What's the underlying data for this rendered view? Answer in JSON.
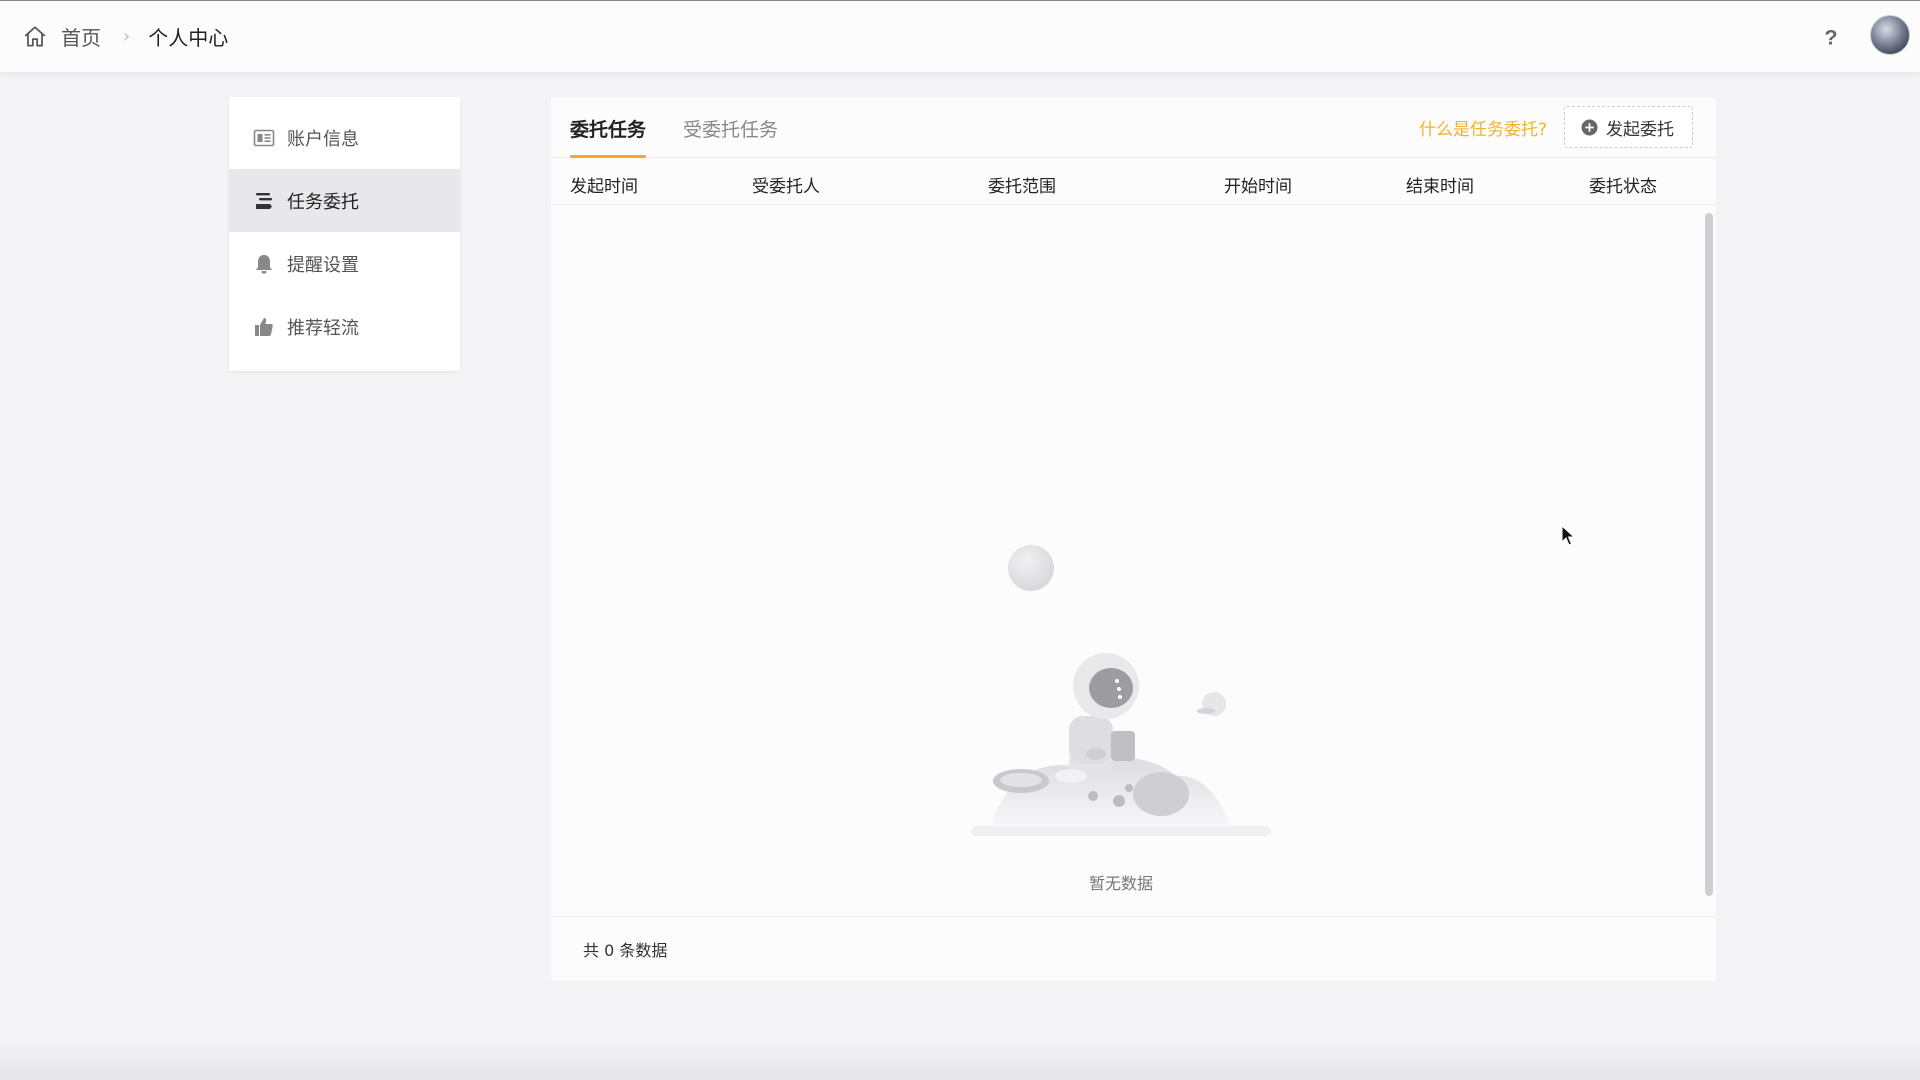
{
  "breadcrumb": {
    "home_icon": "home-icon",
    "home_label": "首页",
    "separator": "›",
    "current": "个人中心"
  },
  "header": {
    "help_icon": "question-icon",
    "avatar": "user-avatar"
  },
  "sidebar": {
    "items": [
      {
        "label": "账户信息",
        "icon": "id-card-icon",
        "active": false
      },
      {
        "label": "任务委托",
        "icon": "delegate-icon",
        "active": true
      },
      {
        "label": "提醒设置",
        "icon": "bell-icon",
        "active": false
      },
      {
        "label": "推荐轻流",
        "icon": "thumbs-up-icon",
        "active": false
      }
    ]
  },
  "main": {
    "tabs": [
      {
        "label": "委托任务",
        "active": true
      },
      {
        "label": "受委托任务",
        "active": false
      }
    ],
    "help_link": "什么是任务委托?",
    "new_button": "发起委托",
    "columns": [
      "发起时间",
      "受委托人",
      "委托范围",
      "开始时间",
      "结束时间",
      "委托状态"
    ],
    "rows": [],
    "empty_text": "暂无数据",
    "footer_text": "共 0 条数据"
  },
  "colors": {
    "accent": "#f5a623",
    "link": "#f0b429",
    "background": "#f4f3f6",
    "active_item": "#e8e8ec"
  }
}
